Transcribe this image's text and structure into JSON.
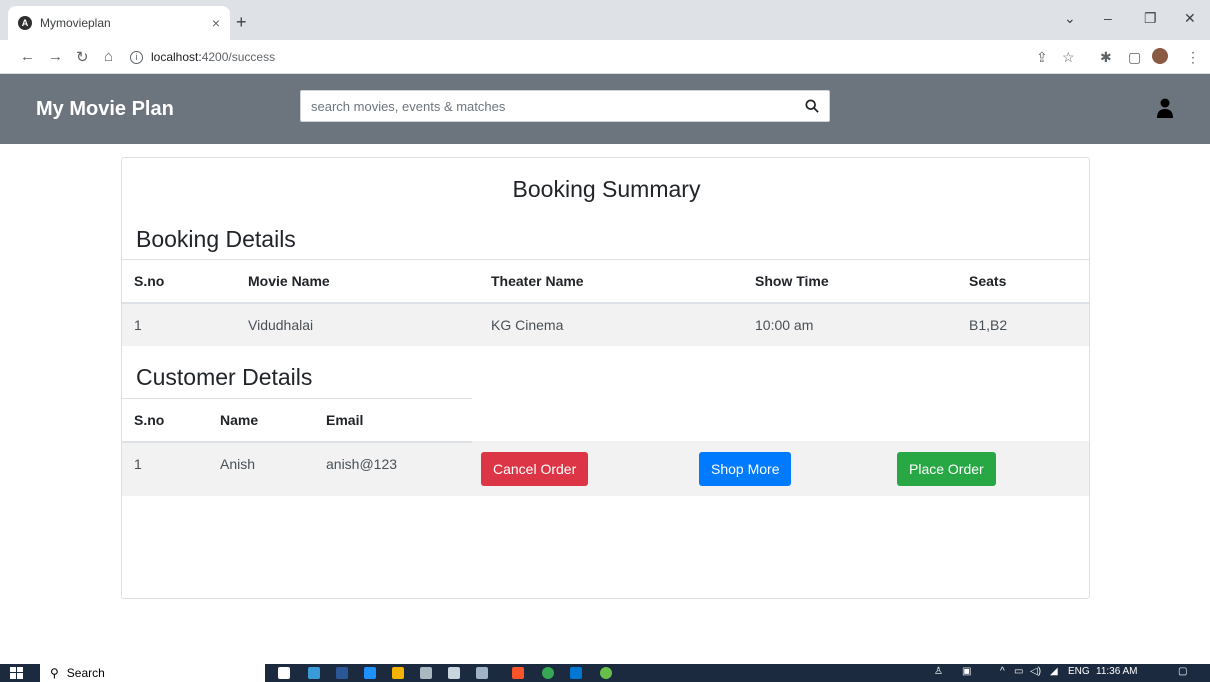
{
  "browser": {
    "tab_title": "Mymovieplan",
    "tab_close": "×",
    "new_tab": "+",
    "url_host": "localhost:",
    "url_path": "4200/success",
    "win_minimize": "–",
    "win_restore": "❐",
    "win_close": "✕",
    "tab_search": "⌄"
  },
  "app": {
    "brand": "My Movie Plan",
    "search_placeholder": "search movies, events & matches"
  },
  "summary": {
    "title": "Booking Summary",
    "booking_heading": "Booking Details",
    "booking_columns": [
      "S.no",
      "Movie Name",
      "Theater Name",
      "Show Time",
      "Seats"
    ],
    "booking_rows": [
      [
        "1",
        "Vidudhalai",
        "KG Cinema",
        "10:00 am",
        "B1,B2"
      ]
    ],
    "customer_heading": "Customer Details",
    "customer_columns": [
      "S.no",
      "Name",
      "Email"
    ],
    "customer_rows": [
      [
        "1",
        "Anish",
        "anish@123"
      ]
    ],
    "buttons": {
      "cancel": "Cancel Order",
      "shop": "Shop More",
      "place": "Place Order"
    }
  },
  "taskbar": {
    "search_label": "Search",
    "lang": "ENG",
    "time": "11:36 AM"
  },
  "colors": {
    "navbar": "#6c757d",
    "danger": "#dc3545",
    "primary": "#007bff",
    "success": "#28a745"
  }
}
